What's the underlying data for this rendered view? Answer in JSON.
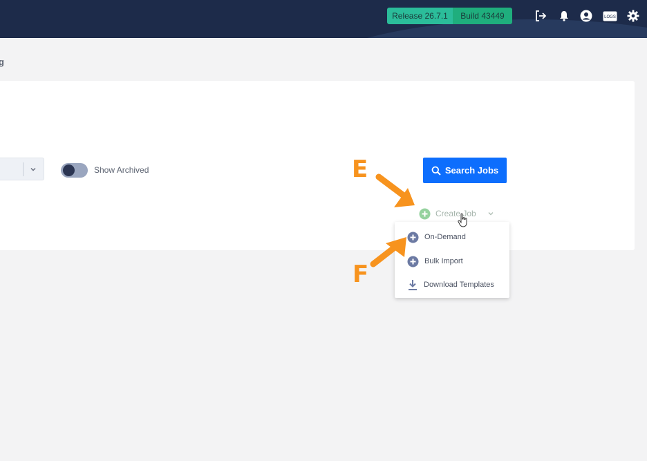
{
  "header": {
    "release": "Release 26.7.1",
    "build": "Build 43449",
    "icons": [
      "logout-icon",
      "bell-icon",
      "user-icon",
      "logs-icon",
      "gear-icon"
    ],
    "logs_icon_text": "LOGS"
  },
  "breadcrumb": "g",
  "filters": {
    "show_archived_label": "Show Archived",
    "show_archived_on": true
  },
  "actions": {
    "search_label": "Search Jobs",
    "create_label": "Create Job"
  },
  "create_menu": {
    "items": [
      {
        "label": "On-Demand",
        "icon": "plus-circle-icon"
      },
      {
        "label": "Bulk Import",
        "icon": "plus-circle-icon"
      },
      {
        "label": "Download Templates",
        "icon": "download-icon"
      }
    ]
  },
  "annotations": {
    "e": "E",
    "f": "F"
  },
  "colors": {
    "topbar": "#1d2b4a",
    "release_badge": "#2bbd9a",
    "build_badge": "#1fae7d",
    "primary_button": "#0d6efd",
    "annotation": "#f7931e"
  }
}
